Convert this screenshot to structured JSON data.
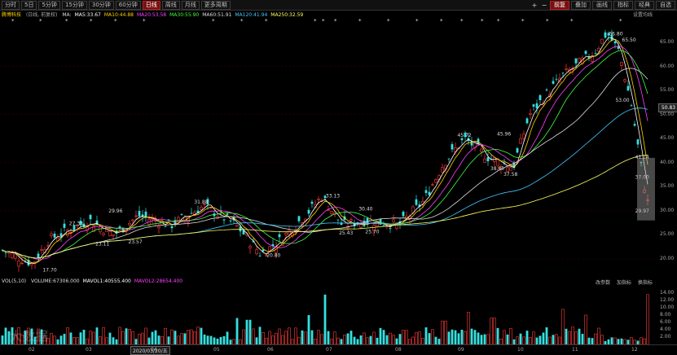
{
  "toolbar": {
    "timeframes": [
      "分时",
      "5日",
      "5分钟",
      "15分钟",
      "30分钟",
      "60分钟",
      "日线",
      "周线",
      "月线",
      "更多周期"
    ],
    "active_timeframe": "日线",
    "right_buttons": [
      "前复",
      "叠加",
      "画线",
      "指标",
      "经典",
      "自选"
    ],
    "active_right": "前复"
  },
  "info": {
    "name": "腾博科技",
    "mode": "(日线, 前复权)",
    "ma": [
      {
        "label": "MA:",
        "color": "#dddddd"
      },
      {
        "label": "MA5:33.67",
        "color": "#ffffff"
      },
      {
        "label": "MA10:44.88",
        "color": "#ffd000"
      },
      {
        "label": "MA20:53.58",
        "color": "#ff40ff"
      },
      {
        "label": "MA30:55.90",
        "color": "#40ff40"
      },
      {
        "label": "MA60:51.91",
        "color": "#dddddd"
      },
      {
        "label": "MA120:41.94",
        "color": "#40c8ff"
      },
      {
        "label": "MA250:32.59",
        "color": "#ffff60"
      }
    ],
    "settings": "设置均线"
  },
  "axis_right": [
    "65.00",
    "60.00",
    "55.00",
    "50.00",
    "45.00",
    "40.00",
    "35.00",
    "30.00",
    "25.00",
    "20.00"
  ],
  "current_price": "50.83",
  "vol": {
    "label": "VOL(5,10)",
    "items": [
      {
        "label": "VOLUME:67306.000",
        "color": "#dddddd"
      },
      {
        "label": "MAVOL1:40555.400",
        "color": "#ffffff"
      },
      {
        "label": "MAVOL2:28654.400",
        "color": "#ff40ff"
      }
    ],
    "tools": [
      "改参数",
      "加指标",
      "换指标"
    ],
    "axis": [
      "14.00",
      "12.00",
      "10.00",
      "8.00",
      "6.00",
      "4.00",
      "2.00"
    ],
    "unit": "万"
  },
  "dates": [
    "02",
    "03",
    "04",
    "05",
    "06",
    "07",
    "08",
    "09",
    "10",
    "11",
    "12"
  ],
  "cursor_date": "2020/03/20/五",
  "watermark": "大数据",
  "chart_data": {
    "type": "candlestick",
    "ylim": [
      18,
      68
    ],
    "annotations": [
      {
        "label": "17.70",
        "x": 0.06,
        "y": 17.7
      },
      {
        "label": "27.33",
        "x": 0.1,
        "y": 27.33
      },
      {
        "label": "23.11",
        "x": 0.14,
        "y": 23.11
      },
      {
        "label": "29.96",
        "x": 0.16,
        "y": 29.96
      },
      {
        "label": "23.57",
        "x": 0.19,
        "y": 23.57
      },
      {
        "label": "31.88",
        "x": 0.29,
        "y": 31.88
      },
      {
        "label": "20.80",
        "x": 0.4,
        "y": 20.8
      },
      {
        "label": "33.13",
        "x": 0.49,
        "y": 33.13
      },
      {
        "label": "25.43",
        "x": 0.51,
        "y": 25.43
      },
      {
        "label": "30.40",
        "x": 0.54,
        "y": 30.4
      },
      {
        "label": "25.70",
        "x": 0.55,
        "y": 25.7
      },
      {
        "label": "45.72",
        "x": 0.69,
        "y": 45.72
      },
      {
        "label": "45.96",
        "x": 0.75,
        "y": 45.96
      },
      {
        "label": "38.80",
        "x": 0.74,
        "y": 38.8
      },
      {
        "label": "37.58",
        "x": 0.76,
        "y": 37.58
      },
      {
        "label": "66.80",
        "x": 0.92,
        "y": 66.8
      },
      {
        "label": "65.50",
        "x": 0.94,
        "y": 65.5
      },
      {
        "label": "53.00",
        "x": 0.93,
        "y": 53.0
      },
      {
        "label": "41.14",
        "x": 0.96,
        "y": 41.14
      },
      {
        "label": "37.00",
        "x": 0.96,
        "y": 37.0
      },
      {
        "label": "29.97",
        "x": 0.96,
        "y": 29.97
      }
    ]
  }
}
